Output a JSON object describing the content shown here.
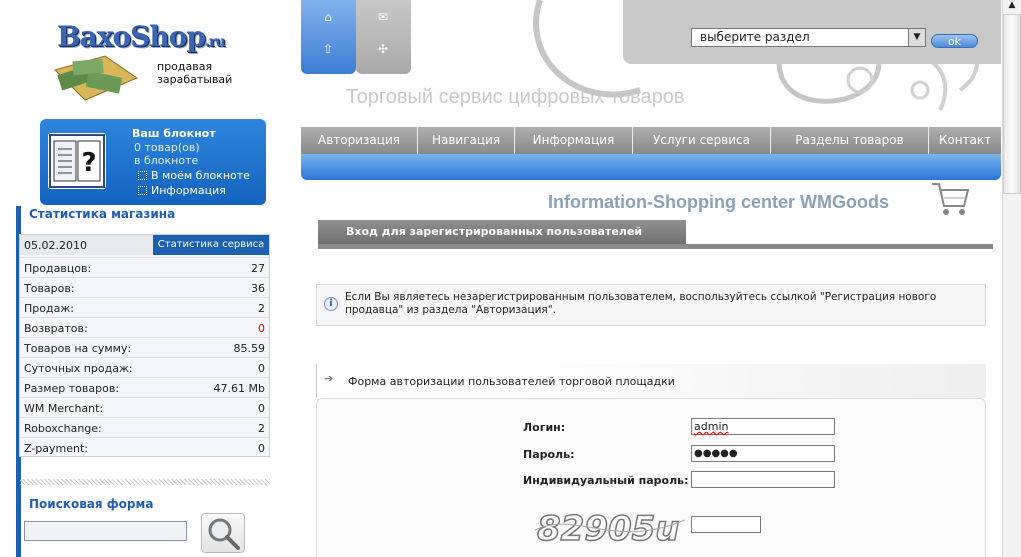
{
  "logo": {
    "brand": "BaxoShop",
    "brand_tld": ".ru",
    "slogan_line1": "продавая",
    "slogan_line2": "зарабатывай"
  },
  "notebook": {
    "title": "Ваш блокнот",
    "count_line": "0 товар(ов)",
    "in_notebook": "в блокноте",
    "link_my": "В моём блокноте",
    "link_info": "Информация"
  },
  "stats": {
    "title": "Статистика магазина",
    "date": "05.02.2010",
    "service_label": "Статистика сервиса",
    "rows": [
      {
        "label": "Продавцов:",
        "value": "27"
      },
      {
        "label": "Товаров:",
        "value": "36"
      },
      {
        "label": "Продаж:",
        "value": "2"
      },
      {
        "label": "Возвратов:",
        "value": "0"
      },
      {
        "label": "Товаров на сумму:",
        "value": "85.59"
      },
      {
        "label": "Суточных продаж:",
        "value": "0"
      },
      {
        "label": "Размер товаров:",
        "value": "47.61 Mb"
      },
      {
        "label": "WM Merchant:",
        "value": "0"
      },
      {
        "label": "Roboxchange:",
        "value": "2"
      },
      {
        "label": "Z-payment:",
        "value": "0"
      }
    ]
  },
  "search": {
    "title": "Поисковая форма",
    "value": ""
  },
  "header": {
    "site_title": "Торговый сервис цифровых товаров",
    "section_select": "выберите раздел",
    "ok_label": "ok"
  },
  "nav": {
    "items": [
      "Авторизация",
      "Навигация",
      "Информация",
      "Услуги сервиса",
      "Разделы товаров",
      "Контакт"
    ]
  },
  "content": {
    "center_title": "Information-Shopping center WMGoods",
    "login_tab": "Вход для зарегистрированных пользователей",
    "info_text": "Если Вы являетесь незарегистрированным пользователем, воспользуйтесь ссылкой \"Регистрация нового продавца\" из раздела \"Авторизация\".",
    "form_title": "Форма авторизации пользователей торговой площадки",
    "login_label": "Логин:",
    "login_value": "admin",
    "password_label": "Пароль:",
    "password_value": "●●●●●",
    "ind_password_label": "Индивидуальный пароль:",
    "ind_password_value": "",
    "captcha_text": "82905u",
    "captcha_value": ""
  },
  "colors": {
    "accent_blue": "#1d5fb1",
    "nav_gray": "#8a8a8a",
    "red": "#dd0000"
  }
}
